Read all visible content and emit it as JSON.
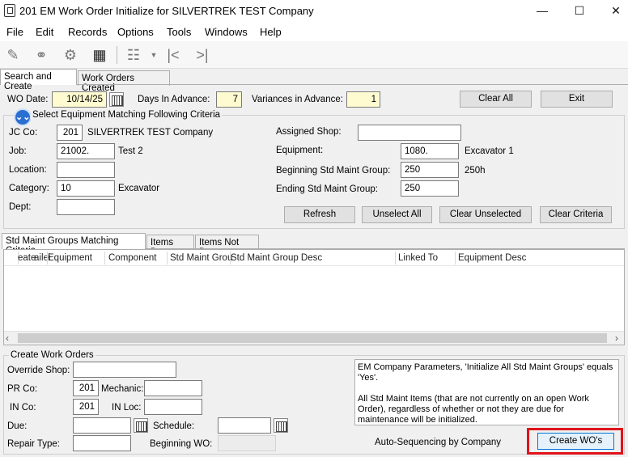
{
  "window": {
    "title": "201 EM Work Order Initialize for SILVERTREK TEST Company",
    "minimize": "—",
    "maximize": "☐",
    "close": "✕"
  },
  "menu": [
    "File",
    "Edit",
    "Records",
    "Options",
    "Tools",
    "Windows",
    "Help"
  ],
  "toolbar": {
    "icons": [
      "edit-icon",
      "binoculars-icon",
      "settings-gear-icon",
      "calculator-icon",
      "grid-view-icon",
      "first-record-icon",
      "last-record-icon"
    ]
  },
  "tabs": {
    "main": [
      "Search and Create",
      "Work Orders Created"
    ],
    "active": "Search and Create"
  },
  "top": {
    "wo_date_label": "WO Date:",
    "wo_date": "10/14/25",
    "days_label": "Days In Advance:",
    "days": "7",
    "variances_label": "Variances in Advance:",
    "variances": "1",
    "clear_all": "Clear All",
    "exit": "Exit"
  },
  "criteria": {
    "legend": "Select Equipment Matching Following Criteria",
    "jcco_label": "JC Co:",
    "jcco": "201",
    "jcco_desc": "SILVERTREK TEST Company",
    "job_label": "Job:",
    "job": "21002.",
    "job_desc": "Test 2",
    "location_label": "Location:",
    "location": "",
    "category_label": "Category:",
    "category": "10",
    "category_desc": "Excavator",
    "dept_label": "Dept:",
    "dept": "",
    "shop_label": "Assigned Shop:",
    "shop": "",
    "equipment_label": "Equipment:",
    "equipment": "1080.",
    "equipment_desc": "Excavator 1",
    "begin_label": "Beginning Std Maint Group:",
    "begin": "250",
    "begin_desc": "250h",
    "end_label": "Ending Std Maint Group:",
    "end": "250",
    "refresh": "Refresh",
    "unselect_all": "Unselect All",
    "clear_unselected": "Clear Unselected",
    "clear_criteria": "Clear Criteria"
  },
  "grid": {
    "tabs": [
      "Std Maint Groups Matching Criteria",
      "Items Due",
      "Items Not Due"
    ],
    "columns": [
      "eate",
      "ailei",
      "Equipment",
      "Component",
      "Std Maint Grou",
      "Std Maint Group Desc",
      "Linked To",
      "Equipment Desc"
    ]
  },
  "create": {
    "legend": "Create Work Orders",
    "override_label": "Override Shop:",
    "override": "",
    "prco_label": "PR Co:",
    "prco": "201",
    "mechanic_label": "Mechanic:",
    "mechanic": "",
    "inco_label": "IN Co:",
    "inco": "201",
    "inloc_label": "IN Loc:",
    "inloc": "",
    "due_label": "Due:",
    "due": "",
    "schedule_label": "Schedule:",
    "schedule": "",
    "repair_label": "Repair Type:",
    "repair": "",
    "beginwo_label": "Beginning WO:",
    "beginwo": "",
    "info1": "EM Company Parameters, 'Initialize All Std Maint Groups' equals 'Yes'.",
    "info2": "All Std Maint Items (that are not currently on an open Work Order), regardless of whether or not they are due for maintenance will be initialized.",
    "autoseq": "Auto-Sequencing by Company",
    "create_btn": "Create WO's"
  },
  "colors": {
    "highlight": "#e0131b",
    "yellow_field": "#fffbd0"
  }
}
